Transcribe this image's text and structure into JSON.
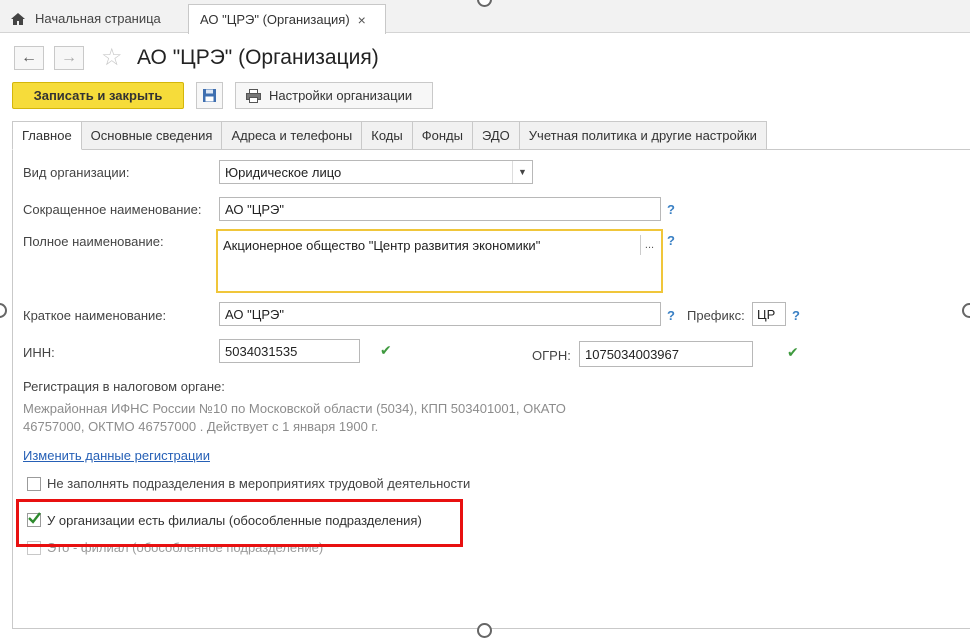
{
  "tabs": {
    "home": "Начальная страница",
    "document": "АО \"ЦРЭ\" (Организация)",
    "close": "×"
  },
  "header": {
    "title": "АО \"ЦРЭ\" (Организация)",
    "back": "←",
    "forward": "→",
    "star": "☆"
  },
  "toolbar": {
    "save_close": "Записать и закрыть",
    "settings": "Настройки организации"
  },
  "form_tabs": [
    "Главное",
    "Основные сведения",
    "Адреса и телефоны",
    "Коды",
    "Фонды",
    "ЭДО",
    "Учетная политика и другие настройки"
  ],
  "form": {
    "org_type_label": "Вид организации:",
    "org_type_value": "Юридическое лицо",
    "short_name_label": "Сокращенное наименование:",
    "short_name_value": "АО \"ЦРЭ\"",
    "full_name_label": "Полное наименование:",
    "full_name_value": "Акционерное общество  \"Центр развития экономики\"",
    "brief_name_label": "Краткое наименование:",
    "brief_name_value": "АО \"ЦРЭ\"",
    "prefix_label": "Префикс:",
    "prefix_value": "ЦР",
    "inn_label": "ИНН:",
    "inn_value": "5034031535",
    "ogrn_label": "ОГРН:",
    "ogrn_value": "1075034003967",
    "help": "?",
    "ellipsis": "...",
    "valid_mark": "✔",
    "tax_reg_label": "Регистрация в налоговом органе:",
    "tax_reg_line1": "Межрайонная ИФНС России №10 по Московской области (5034), КПП 503401001, ОКАТО",
    "tax_reg_line2": "46757000, ОКТМО 46757000   . Действует с 1 января 1900 г.",
    "change_reg_link": "Изменить данные регистрации",
    "cb_no_fill_label": "Не заполнять подразделения в мероприятиях трудовой деятельности",
    "cb_no_fill_checked": false,
    "cb_has_branches_label": "У организации есть филиалы (обособленные подразделения)",
    "cb_has_branches_checked": true,
    "cb_is_branch_label": "Это - филиал (обособленное подразделение)",
    "cb_is_branch_checked": false
  },
  "colors": {
    "primary_button": "#f6dc3a",
    "highlight": "#e81010",
    "link": "#2660b6",
    "help": "#3a80c4",
    "check": "#3f9a3f"
  }
}
